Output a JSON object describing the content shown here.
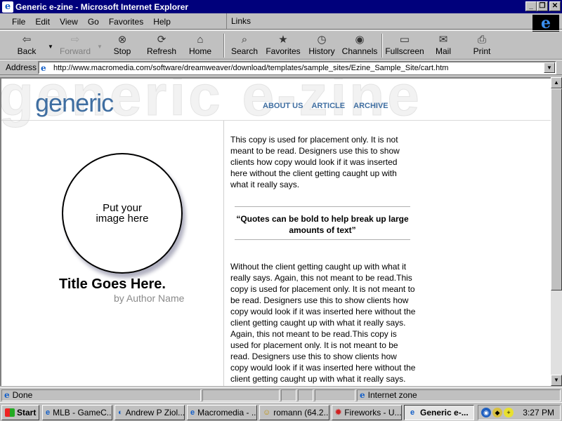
{
  "window": {
    "title": "Generic e-zine - Microsoft Internet Explorer",
    "minimize_glyph": "_",
    "restore_glyph": "❐",
    "close_glyph": "✕"
  },
  "menu": {
    "items": [
      "File",
      "Edit",
      "View",
      "Go",
      "Favorites",
      "Help"
    ],
    "links_label": "Links"
  },
  "toolbar": {
    "buttons": [
      {
        "label": "Back",
        "icon": "back-arrow-icon",
        "glyph": "⇦"
      },
      {
        "label": "Forward",
        "icon": "forward-arrow-icon",
        "glyph": "⇨",
        "disabled": true
      },
      {
        "label": "Stop",
        "icon": "stop-icon",
        "glyph": "⊗"
      },
      {
        "label": "Refresh",
        "icon": "refresh-icon",
        "glyph": "⟳"
      },
      {
        "label": "Home",
        "icon": "home-icon",
        "glyph": "⌂"
      },
      {
        "label": "Search",
        "icon": "search-icon",
        "glyph": "⌕"
      },
      {
        "label": "Favorites",
        "icon": "favorites-icon",
        "glyph": "★"
      },
      {
        "label": "History",
        "icon": "history-icon",
        "glyph": "◷"
      },
      {
        "label": "Channels",
        "icon": "channels-icon",
        "glyph": "◉"
      },
      {
        "label": "Fullscreen",
        "icon": "fullscreen-icon",
        "glyph": "▭"
      },
      {
        "label": "Mail",
        "icon": "mail-icon",
        "glyph": "✉"
      },
      {
        "label": "Print",
        "icon": "print-icon",
        "glyph": "⎙"
      }
    ]
  },
  "address": {
    "label": "Address",
    "url": "http://www.macromedia.com/software/dreamweaver/download/templates/sample_sites/Ezine_Sample_Site/cart.htm"
  },
  "page": {
    "background_word": "generic e-zine",
    "logo": "generic",
    "nav": [
      "ABOUT US",
      "ARTICLE",
      "ARCHIVE"
    ],
    "image_placeholder": "Put your image here",
    "article_title": "Title Goes Here.",
    "article_author": "by Author Name",
    "copy1": "This copy is used for placement only. It is not meant to be read. Designers use this to show clients how copy would look if it was inserted here without the client getting caught up with what it really says.",
    "quote": "“Quotes can be bold to help break up large amounts of text”",
    "copy2": "Without the client getting caught up with what it really says. Again, this not meant to be read.This copy is used for placement only. It is not meant to be read. Designers use this to show clients how copy would look if it was inserted here without the client getting caught up with what it really says. Again, this not meant to be read.This copy is used for placement only. It is not meant to be read. Designers use this to show clients how copy would look if it was inserted here without the client getting caught up with what it really says."
  },
  "statusbar": {
    "status": "Done",
    "zone": "Internet zone"
  },
  "taskbar": {
    "start_label": "Start",
    "tasks": [
      {
        "label": "MLB - GameC...",
        "icon": "ie-icon"
      },
      {
        "label": "Andrew P Ziol...",
        "icon": "netscape-icon"
      },
      {
        "label": "Macromedia - ...",
        "icon": "ie-icon"
      },
      {
        "label": "romann (64.2...",
        "icon": "chat-icon"
      },
      {
        "label": "Fireworks - U...",
        "icon": "fireworks-icon"
      },
      {
        "label": "Generic e-...",
        "icon": "ie-icon",
        "active": true
      }
    ],
    "clock": "3:27 PM"
  },
  "colors": {
    "titlebar": "#00007b",
    "brand_blue": "#3f6ea1",
    "chrome": "#c0c0c0"
  }
}
